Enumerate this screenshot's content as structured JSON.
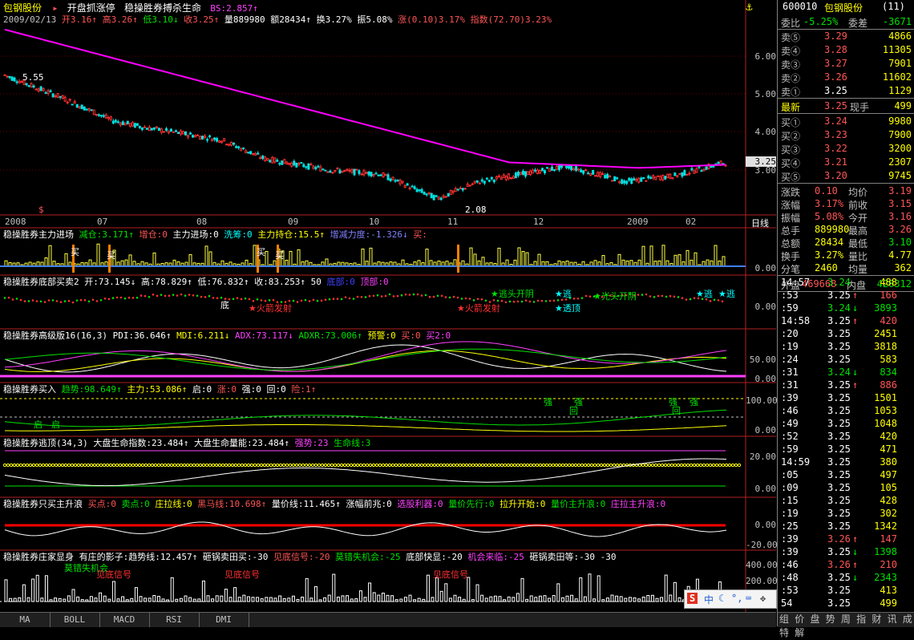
{
  "header": {
    "stock_name": "包钢股份",
    "marker": "▸",
    "indicator_name": "开盘抓涨停",
    "indicator2": "稳操胜券搏杀生命",
    "bs": "BS:2.857↑",
    "info_line": {
      "date": "2009/02/13",
      "open": "开3.16↑",
      "high": "高3.26↑",
      "low": "低3.10↓",
      "close": "收3.25↑",
      "volume": "量889980",
      "amount": "额28434↑",
      "turnover": "换3.27%",
      "amplitude": "振5.08%",
      "change": "涨(0.10)3.17%",
      "index": "指数(72.70)3.23%"
    },
    "anchor_icon": "anchor-icon"
  },
  "price_axis": [
    "6.00",
    "5.00",
    "4.00",
    "3.00"
  ],
  "price_badge": "3.25",
  "price_marks": {
    "high": "5.55",
    "low": "2.08",
    "low_marker": "$"
  },
  "time_axis": [
    "2008",
    "07",
    "08",
    "09",
    "10",
    "11",
    "12",
    "2009",
    "02"
  ],
  "period_label": "日线",
  "panels": [
    {
      "title": "稳操胜券主力进场",
      "items": [
        {
          "text": "减仓:3.171↑",
          "color": "#00e000"
        },
        {
          "text": "增仓:0",
          "color": "#ff5555"
        },
        {
          "text": "主力进场:0",
          "color": "#ffffff"
        },
        {
          "text": "洗筹:0",
          "color": "#00ffff"
        },
        {
          "text": "主力持仓:15.5↑",
          "color": "#ffff00"
        },
        {
          "text": "增减力度:-1.326↓",
          "color": "#8080ff"
        },
        {
          "text": "买:",
          "color": "#ff5555"
        }
      ],
      "axis": [
        "0.00"
      ],
      "labels": [
        "买",
        "买",
        "买",
        "买"
      ]
    },
    {
      "title": "稳操胜券底部买卖2",
      "items": [
        {
          "text": "开:73.145↓",
          "color": "#ffffff"
        },
        {
          "text": "高:78.829↑",
          "color": "#ffffff"
        },
        {
          "text": "低:76.832↑",
          "color": "#ffffff"
        },
        {
          "text": "收:83.253↑",
          "color": "#ffffff"
        },
        {
          "text": "50",
          "color": "#ffffff"
        },
        {
          "text": "底部:0",
          "color": "#4040ff"
        },
        {
          "text": "顶部:0",
          "color": "#ff40ff"
        }
      ],
      "axis": [
        "0.00"
      ],
      "labels": [
        "底",
        "★火箭发射",
        "★火箭发射",
        "★逃头开阴",
        "★透顶",
        "★逃",
        "★光头开阴",
        "★逃",
        "★逃"
      ]
    },
    {
      "title": "稳操胜券高级版16(16,3)",
      "items": [
        {
          "text": "PDI:36.646↑",
          "color": "#ffffff"
        },
        {
          "text": "MDI:6.211↓",
          "color": "#ffff00"
        },
        {
          "text": "ADX:73.117↓",
          "color": "#ff40ff"
        },
        {
          "text": "ADXR:73.006↑",
          "color": "#00e000"
        },
        {
          "text": "预警:0",
          "color": "#ffff00"
        },
        {
          "text": "买:0",
          "color": "#ff5555"
        },
        {
          "text": "买2:0",
          "color": "#ff40ff"
        }
      ],
      "axis": [
        "50.00",
        "0.00"
      ]
    },
    {
      "title": "稳操胜券买入",
      "items": [
        {
          "text": "趋势:98.649↑",
          "color": "#00e000"
        },
        {
          "text": "主力:53.086↑",
          "color": "#ffff00"
        },
        {
          "text": "启:0",
          "color": "#ffffff"
        },
        {
          "text": "涨:0",
          "color": "#ff5555"
        },
        {
          "text": "强:0",
          "color": "#ffffff"
        },
        {
          "text": "回:0",
          "color": "#ffffff"
        },
        {
          "text": "险:1↑",
          "color": "#ff5555"
        }
      ],
      "axis": [
        "100.00",
        "0.00"
      ],
      "labels": [
        "启",
        "启",
        "强",
        "强",
        "回",
        "强",
        "强",
        "回"
      ]
    },
    {
      "title": "稳操胜券逃顶(34,3)",
      "items": [
        {
          "text": "大盘生命指数:23.484↑",
          "color": "#ffffff"
        },
        {
          "text": "大盘生命量能:23.484↑",
          "color": "#ffffff"
        },
        {
          "text": "强势:23",
          "color": "#ff40ff"
        },
        {
          "text": "生命线:3",
          "color": "#00e000"
        }
      ],
      "axis": [
        "20.00",
        "0.00"
      ]
    },
    {
      "title": "稳操胜券只买主升浪",
      "items": [
        {
          "text": "买点:0",
          "color": "#ff5555"
        },
        {
          "text": "卖点:0",
          "color": "#00e000"
        },
        {
          "text": "庄拉线:0",
          "color": "#ffff00"
        },
        {
          "text": "黑马线:10.698↑",
          "color": "#ff5555"
        },
        {
          "text": "量价线:11.465↑",
          "color": "#ffffff"
        },
        {
          "text": "涨幅前兆:0",
          "color": "#ffffff"
        },
        {
          "text": "选股利器:0",
          "color": "#ff40ff"
        },
        {
          "text": "量价先行:0",
          "color": "#00e000"
        },
        {
          "text": "拉升开始:0",
          "color": "#ffff00"
        },
        {
          "text": "量价主升浪:0",
          "color": "#00e000"
        },
        {
          "text": "庄拉主升浪:0",
          "color": "#ff40ff"
        }
      ],
      "axis": [
        "0.00",
        "-20.00"
      ]
    },
    {
      "title": "稳操胜券庄家显身",
      "items": [
        {
          "text": "有庄的影子:趋势线:12.457↑",
          "color": "#ffffff"
        },
        {
          "text": "砸锅卖田买:-30",
          "color": "#ffffff"
        },
        {
          "text": "见底信号:-20",
          "color": "#ff5555"
        },
        {
          "text": "莫错失机会:-25",
          "color": "#00e000"
        },
        {
          "text": "底部快显:-20",
          "color": "#ffffff"
        },
        {
          "text": "机会来临:-25",
          "color": "#ff40ff"
        },
        {
          "text": "砸锅卖田等:-30",
          "color": "#ffffff"
        },
        {
          "text": "-30",
          "color": "#ffffff"
        }
      ],
      "axis": [
        "400.00",
        "200.00"
      ],
      "labels": [
        "莫错失机会",
        "见底信号",
        "见底信号",
        "见底信号"
      ]
    }
  ],
  "tabs": [
    "MA",
    "BOLL",
    "MACD",
    "RSI",
    "DMI"
  ],
  "quote": {
    "code": "600010",
    "name": "包钢股份",
    "count": "(11)",
    "weibi_label": "委比",
    "weibi_value": "-5.25%",
    "weicha_label": "委差",
    "weicha_value": "-3671",
    "sells": [
      {
        "label": "卖⑤",
        "price": "3.29",
        "vol": "4866"
      },
      {
        "label": "卖④",
        "price": "3.28",
        "vol": "11305"
      },
      {
        "label": "卖③",
        "price": "3.27",
        "vol": "7901"
      },
      {
        "label": "卖②",
        "price": "3.26",
        "vol": "11602"
      },
      {
        "label": "卖①",
        "price": "3.25",
        "vol": "1129"
      }
    ],
    "latest": {
      "label": "最新",
      "price": "3.25",
      "label2": "现手",
      "vol": "499"
    },
    "buys": [
      {
        "label": "买①",
        "price": "3.24",
        "vol": "9980"
      },
      {
        "label": "买②",
        "price": "3.23",
        "vol": "7900"
      },
      {
        "label": "买③",
        "price": "3.22",
        "vol": "3200"
      },
      {
        "label": "买④",
        "price": "3.21",
        "vol": "2307"
      },
      {
        "label": "买⑤",
        "price": "3.20",
        "vol": "9745"
      }
    ],
    "stats": [
      {
        "l1": "涨跌",
        "v1": "0.10",
        "l2": "均价",
        "v2": "3.19"
      },
      {
        "l1": "涨幅",
        "v1": "3.17%",
        "l2": "前收",
        "v2": "3.15"
      },
      {
        "l1": "振幅",
        "v1": "5.08%",
        "l2": "今开",
        "v2": "3.16"
      },
      {
        "l1": "总手",
        "v1": "889980",
        "l2": "最高",
        "v2": "3.26"
      },
      {
        "l1": "总额",
        "v1": "28434",
        "l2": "最低",
        "v2": "3.10"
      },
      {
        "l1": "换手",
        "v1": "3.27%",
        "l2": "量比",
        "v2": "4.77"
      },
      {
        "l1": "分笔",
        "v1": "2460",
        "l2": "均量",
        "v2": "362"
      }
    ],
    "outer_label": "外盘",
    "outer_value": "469668",
    "inner_label": "内盘",
    "inner_value": "420312"
  },
  "ticks": [
    {
      "time": "14:57",
      "price": "3.24",
      "vol": "488",
      "dir": ""
    },
    {
      "time": ":53",
      "price": "3.25",
      "vol": "166",
      "dir": "↑"
    },
    {
      "time": ":59",
      "price": "3.24",
      "vol": "3893",
      "dir": "↓"
    },
    {
      "time": "14:58",
      "price": "3.25",
      "vol": "420",
      "dir": "↑"
    },
    {
      "time": ":20",
      "price": "3.25",
      "vol": "2451",
      "dir": ""
    },
    {
      "time": ":19",
      "price": "3.25",
      "vol": "3818",
      "dir": ""
    },
    {
      "time": ":24",
      "price": "3.25",
      "vol": "583",
      "dir": ""
    },
    {
      "time": ":31",
      "price": "3.24",
      "vol": "834",
      "dir": "↓"
    },
    {
      "time": ":31",
      "price": "3.25",
      "vol": "886",
      "dir": "↑"
    },
    {
      "time": ":39",
      "price": "3.25",
      "vol": "1501",
      "dir": ""
    },
    {
      "time": ":46",
      "price": "3.25",
      "vol": "1053",
      "dir": ""
    },
    {
      "time": ":49",
      "price": "3.25",
      "vol": "1048",
      "dir": ""
    },
    {
      "time": ":52",
      "price": "3.25",
      "vol": "420",
      "dir": ""
    },
    {
      "time": ":59",
      "price": "3.25",
      "vol": "471",
      "dir": ""
    },
    {
      "time": "14:59",
      "price": "3.25",
      "vol": "380",
      "dir": ""
    },
    {
      "time": ":05",
      "price": "3.25",
      "vol": "497",
      "dir": ""
    },
    {
      "time": ":09",
      "price": "3.25",
      "vol": "105",
      "dir": ""
    },
    {
      "time": ":15",
      "price": "3.25",
      "vol": "428",
      "dir": ""
    },
    {
      "time": ":19",
      "price": "3.25",
      "vol": "302",
      "dir": ""
    },
    {
      "time": ":25",
      "price": "3.25",
      "vol": "1342",
      "dir": ""
    },
    {
      "time": ":39",
      "price": "3.26",
      "vol": "147",
      "dir": "↑"
    },
    {
      "time": ":39",
      "price": "3.25",
      "vol": "1398",
      "dir": "↓"
    },
    {
      "time": ":46",
      "price": "3.26",
      "vol": "210",
      "dir": "↑"
    },
    {
      "time": ":48",
      "price": "3.25",
      "vol": "2343",
      "dir": "↓"
    },
    {
      "time": ":53",
      "price": "3.25",
      "vol": "413",
      "dir": ""
    },
    {
      "time": "54",
      "price": "3.25",
      "vol": "499",
      "dir": ""
    }
  ],
  "bottom_right_tabs": "组 价 盘 势 周 指 财 讯 成 特 解",
  "sogou": {
    "logo": "S",
    "text": "中"
  }
}
